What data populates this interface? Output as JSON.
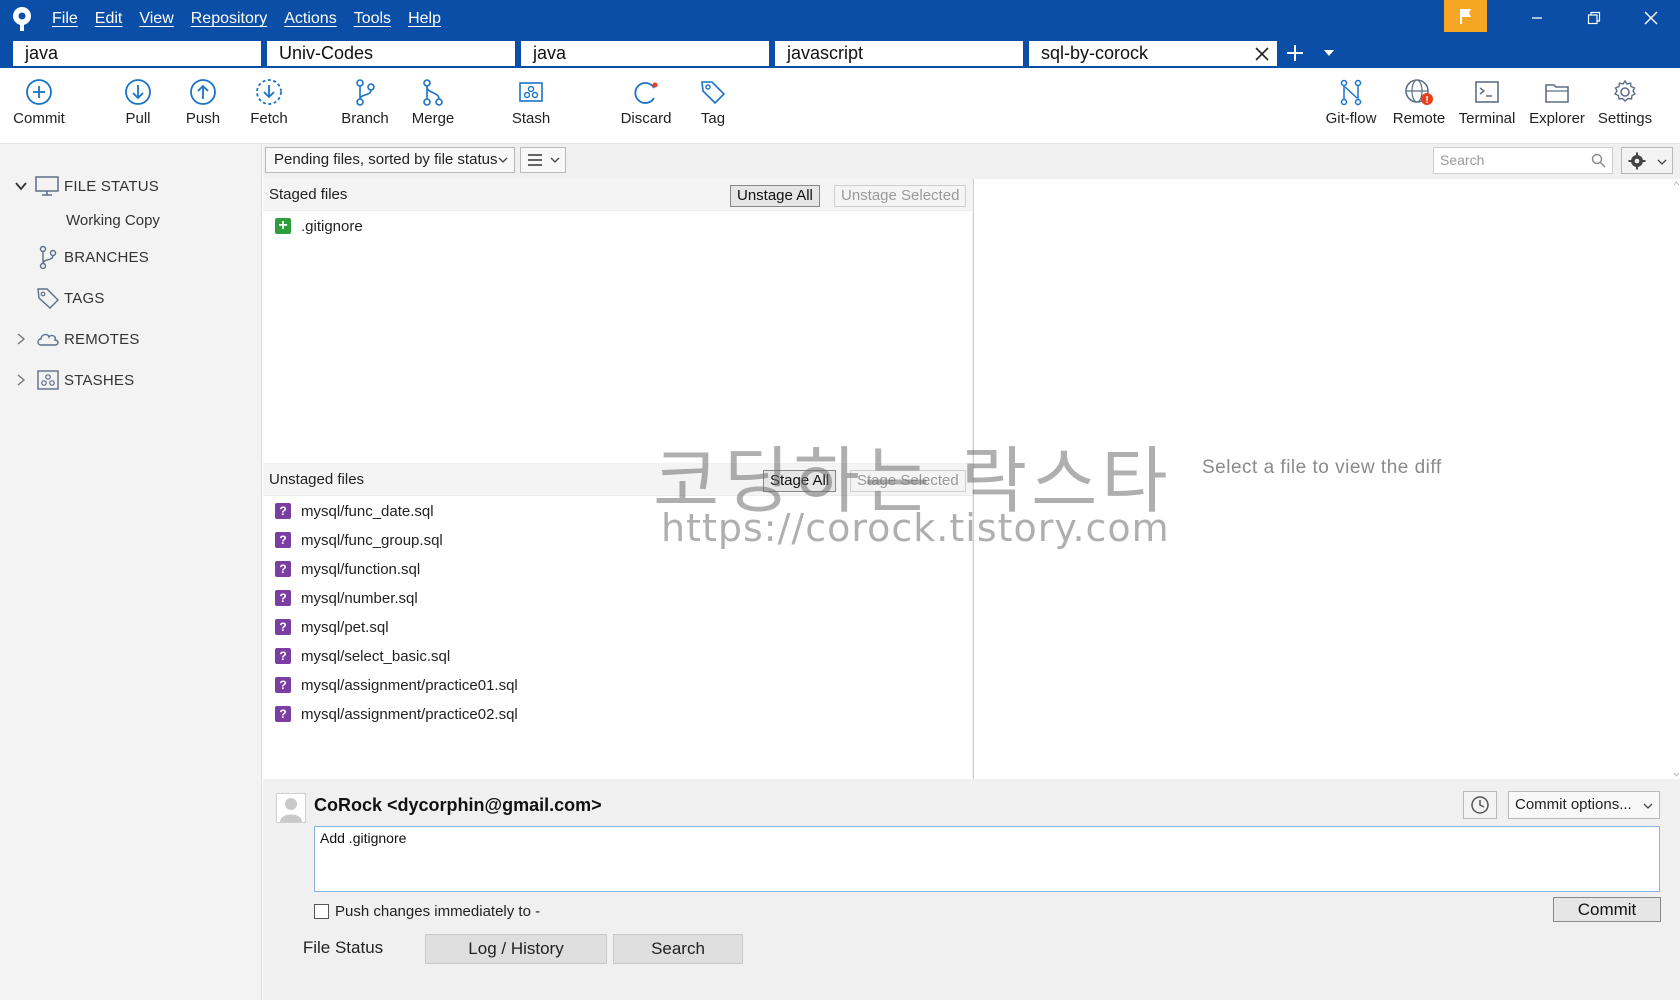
{
  "menu": [
    "File",
    "Edit",
    "View",
    "Repository",
    "Actions",
    "Tools",
    "Help"
  ],
  "tabs": [
    "java",
    "Univ-Codes",
    "java",
    "javascript",
    "sql-by-corock"
  ],
  "toolbar": {
    "left": [
      "Commit",
      "Pull",
      "Push",
      "Fetch",
      "Branch",
      "Merge",
      "Stash",
      "Discard",
      "Tag"
    ],
    "right": [
      "Git-flow",
      "Remote",
      "Terminal",
      "Explorer",
      "Settings"
    ]
  },
  "sidebar": {
    "file_status": "FILE STATUS",
    "working_copy": "Working Copy",
    "branches": "BRANCHES",
    "tags": "TAGS",
    "remotes": "REMOTES",
    "stashes": "STASHES"
  },
  "filter": {
    "sort_label": "Pending files, sorted by file status",
    "search_placeholder": "Search"
  },
  "staged": {
    "title": "Staged files",
    "unstage_all": "Unstage All",
    "unstage_selected": "Unstage Selected",
    "files": [
      ".gitignore"
    ]
  },
  "unstaged": {
    "title": "Unstaged files",
    "stage_all": "Stage All",
    "stage_selected": "Stage Selected",
    "files": [
      "mysql/func_date.sql",
      "mysql/func_group.sql",
      "mysql/function.sql",
      "mysql/number.sql",
      "mysql/pet.sql",
      "mysql/select_basic.sql",
      "mysql/assignment/practice01.sql",
      "mysql/assignment/practice02.sql"
    ]
  },
  "diff": {
    "hint": "Select a file to view the diff"
  },
  "watermark": {
    "title": "코딩하는 락스타",
    "url": "https://corock.tistory.com"
  },
  "commit": {
    "author": "CoRock <dycorphin@gmail.com>",
    "options_label": "Commit options...",
    "message": "Add .gitignore",
    "push_label": "Push changes immediately to -",
    "commit_button": "Commit"
  },
  "bottom_tabs": [
    "File Status",
    "Log / History",
    "Search"
  ],
  "colors": {
    "titlebar": "#0a4ea8",
    "accent": "#1a73c9",
    "flag": "#f6a623",
    "added": "#2e9e3a",
    "untracked": "#7b3ea3",
    "remote_badge": "#e8401c"
  }
}
